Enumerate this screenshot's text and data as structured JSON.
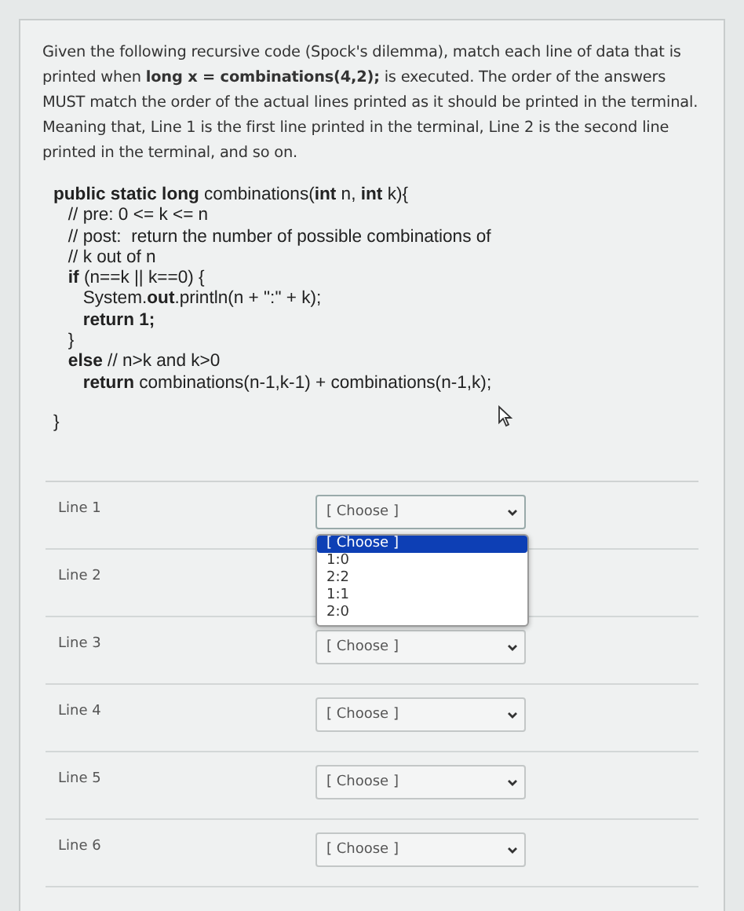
{
  "question": {
    "text": "Given the following recursive code (Spock's dilemma), match each line of data that is printed when **long x = combinations(4,2);** is executed.  The order of the answers MUST match the order of the actual lines printed as it should be printed in the terminal. Meaning that, Line 1 is the first line printed in the terminal, Line 2 is the second line printed in the terminal, and so on."
  },
  "code": {
    "lines": [
      "**public static long** combinations(**int** n, **int** k){",
      "   // pre: 0 <= k <= n",
      "   // post:  return the number of possible combinations of",
      "   // k out of n",
      "   **if** (n==k || k==0) {",
      "      System.**out**.println(n + \":\" + k);",
      "      **return 1;**",
      "   }",
      "   **else** // n>k and k>0",
      "      **return** combinations(n-1,k-1) + combinations(n-1,k);"
    ],
    "closing": "}"
  },
  "matches": [
    {
      "label": "Line 1",
      "value": "[ Choose ]",
      "expanded": true,
      "options": [
        {
          "label": "[ Choose ]",
          "selected": true
        },
        {
          "label": "1:0",
          "selected": false
        },
        {
          "label": "2:2",
          "selected": false
        },
        {
          "label": "1:1",
          "selected": false
        },
        {
          "label": "2:0",
          "selected": false
        }
      ]
    },
    {
      "label": "Line 2",
      "expanded": false
    },
    {
      "label": "Line 3",
      "value": "[ Choose ]",
      "expanded": false
    },
    {
      "label": "Line 4",
      "value": "[ Choose ]",
      "expanded": false
    },
    {
      "label": "Line 5",
      "value": "[ Choose ]",
      "expanded": false
    },
    {
      "label": "Line 6",
      "value": "[ Choose ]",
      "expanded": false
    }
  ]
}
